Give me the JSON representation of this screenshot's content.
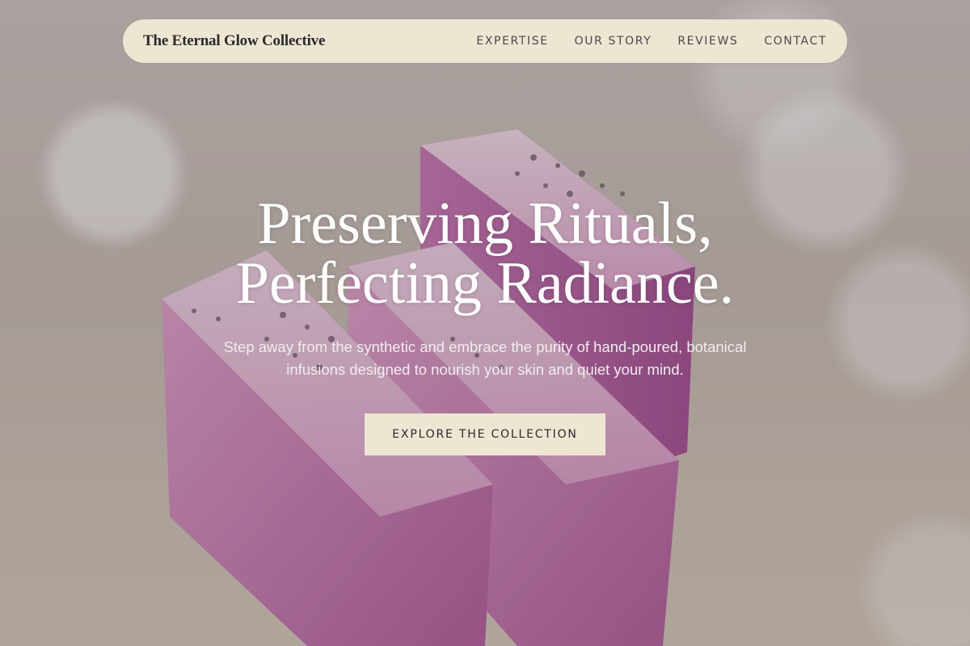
{
  "brand": {
    "name": "The Eternal Glow Collective"
  },
  "nav": {
    "items": [
      {
        "label": "EXPERTISE"
      },
      {
        "label": "OUR STORY"
      },
      {
        "label": "REVIEWS"
      },
      {
        "label": "CONTACT"
      }
    ]
  },
  "hero": {
    "headline_line1": "Preserving Rituals,",
    "headline_line2": "Perfecting Radiance.",
    "subtext": "Step away from the synthetic and embrace the purity of hand-poured, botanical infusions designed to nourish your skin and quiet your mind.",
    "cta_label": "EXPLORE THE COLLECTION",
    "image_subject": "lavender soap bars"
  },
  "colors": {
    "pill_background": "#ede6d3",
    "text_dark": "#2a2a2a",
    "hero_text": "#ffffff",
    "soap_pink": "#d67fb9"
  }
}
